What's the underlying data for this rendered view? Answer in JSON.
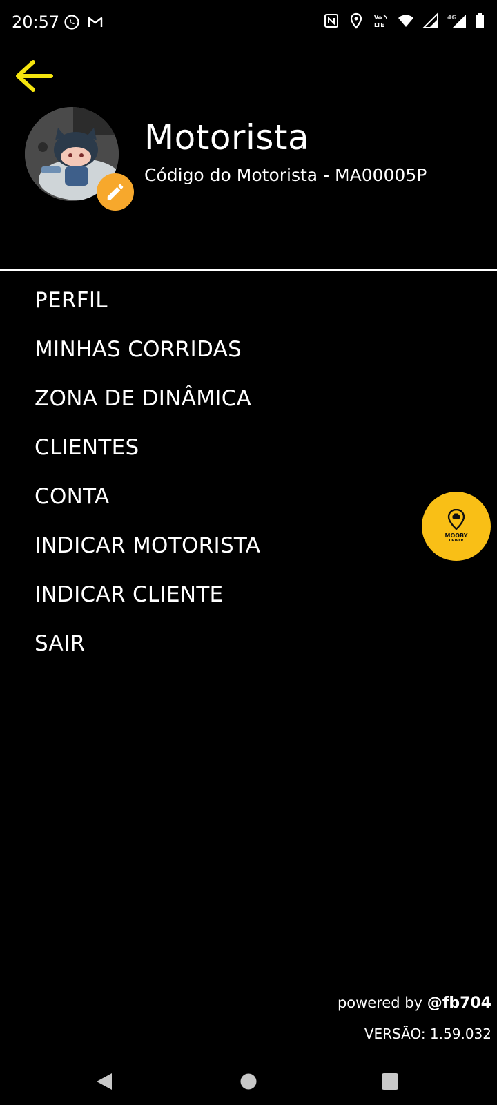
{
  "status_bar": {
    "time": "20:57",
    "left_icons": [
      "whatsapp-icon",
      "gmail-icon"
    ],
    "right_icons": [
      "nfc-icon",
      "location-icon",
      "volte-icon",
      "wifi-icon",
      "signal-icon",
      "4g-signal-icon",
      "battery-icon"
    ],
    "volte_label": "Vo LTE",
    "network_label": "4G"
  },
  "header": {
    "back_icon": "arrow-left-icon",
    "accent_color": "#f5e50e"
  },
  "profile": {
    "name": "Motorista",
    "code": "Código do Motorista - MA00005P",
    "edit_icon": "pencil-icon",
    "edit_color": "#f7a82c"
  },
  "menu": {
    "items": [
      {
        "label": "PERFIL"
      },
      {
        "label": "MINHAS CORRIDAS"
      },
      {
        "label": "ZONA DE DINÂMICA"
      },
      {
        "label": "CLIENTES"
      },
      {
        "label": "CONTA"
      },
      {
        "label": "INDICAR MOTORISTA"
      },
      {
        "label": "INDICAR CLIENTE"
      },
      {
        "label": "SAIR"
      }
    ]
  },
  "fab": {
    "title": "MOOBY",
    "subtitle": "DRIVER",
    "color": "#f9bf16",
    "icon": "map-pin-car-icon"
  },
  "footer": {
    "powered_prefix": "powered by ",
    "powered_handle": "@fb704",
    "version": "VERSÃO: 1.59.032"
  },
  "nav_bar": {
    "icons": [
      "back-triangle-icon",
      "home-circle-icon",
      "recents-square-icon"
    ]
  }
}
